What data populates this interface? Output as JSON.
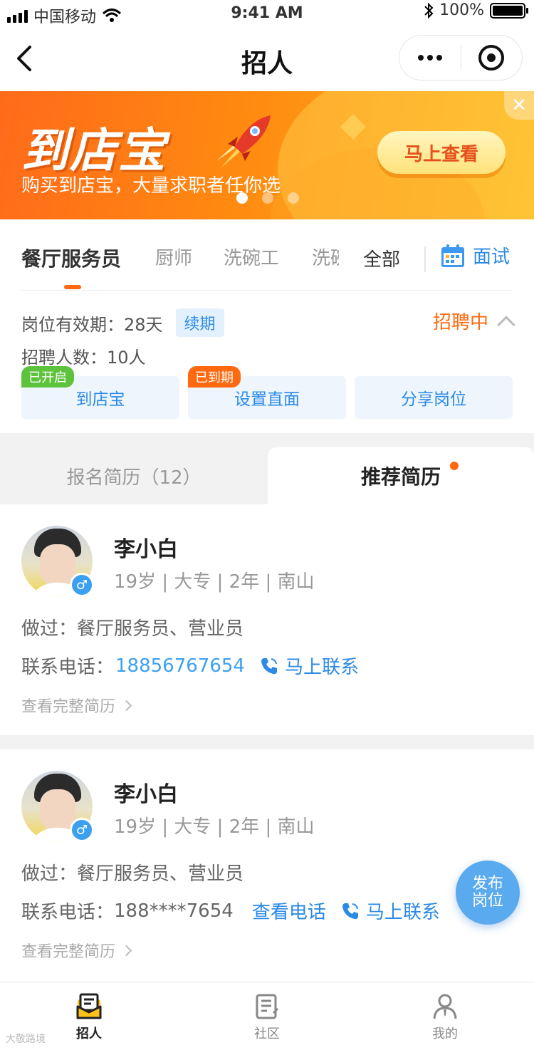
{
  "status_bar": {
    "carrier": "中国移动",
    "time": "9:41 AM",
    "battery": "100%"
  },
  "nav": {
    "title": "招人"
  },
  "banner": {
    "logo": "到店宝",
    "subtitle": "购买到店宝，大量求职者任你选",
    "cta": "马上查看",
    "close": "✕"
  },
  "job_tabs": {
    "items": [
      "餐厅服务员",
      "厨师",
      "洗碗工",
      "洗碗"
    ],
    "all": "全部",
    "interview": "面试"
  },
  "job": {
    "validity_label": "岗位有效期：",
    "validity_value": "28天",
    "renew": "续期",
    "headcount_label": "招聘人数：",
    "headcount_value": "10人",
    "status": "招聘中"
  },
  "actions": [
    {
      "label": "到店宝",
      "tag": "已开启"
    },
    {
      "label": "设置直面",
      "tag": "已到期"
    },
    {
      "label": "分享岗位"
    }
  ],
  "resume_tabs": {
    "signup": "报名简历（12）",
    "recommend": "推荐简历"
  },
  "candidates": [
    {
      "name": "李小白",
      "meta": "19岁 | 大专 | 2年 | 南山",
      "experience": "做过：餐厅服务员、营业员",
      "phone_label": "联系电话：",
      "phone": "18856767654",
      "contact": "马上联系",
      "full": "查看完整简历"
    },
    {
      "name": "李小白",
      "meta": "19岁 | 大专 | 2年 | 南山",
      "experience": "做过：餐厅服务员、营业员",
      "phone_label": "联系电话：",
      "phone": "188****7654",
      "view_phone": "查看电话",
      "contact": "马上联系",
      "full": "查看完整简历"
    }
  ],
  "fab": {
    "line1": "发布",
    "line2": "岗位"
  },
  "tabbar": [
    {
      "label": "招人",
      "icon": "recruit-icon"
    },
    {
      "label": "社区",
      "icon": "community-icon"
    },
    {
      "label": "我的",
      "icon": "profile-icon"
    }
  ],
  "watermark": "大敬路境"
}
